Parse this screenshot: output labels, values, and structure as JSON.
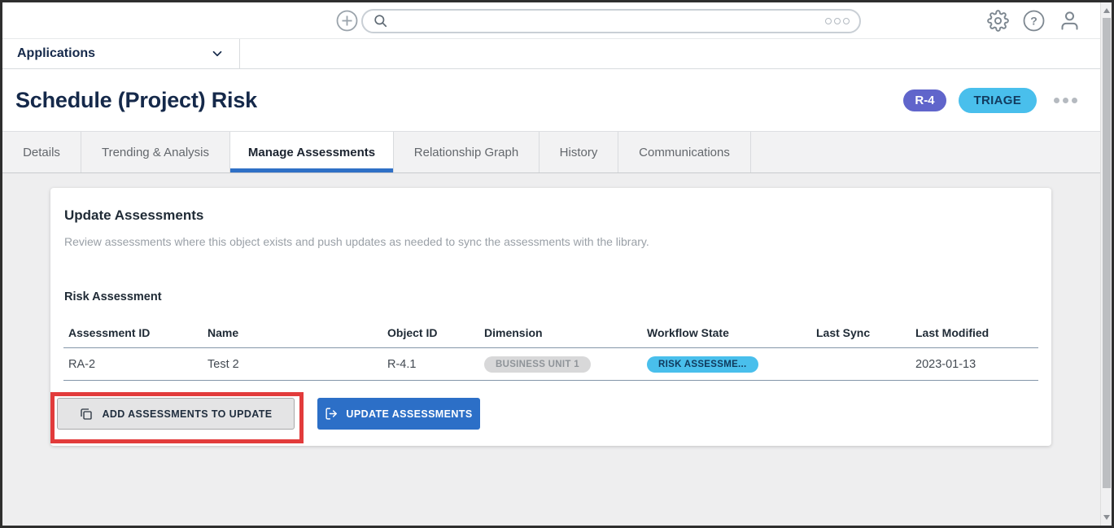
{
  "topbar": {
    "search": {
      "value": "",
      "placeholder": ""
    },
    "icons": {
      "plus": "plus-circle-icon",
      "search": "magnifier-icon",
      "search_options": "triple-dot-icon",
      "settings": "gear-icon",
      "help": "question-circle-icon",
      "user": "person-icon"
    }
  },
  "app_nav": {
    "label": "Applications"
  },
  "header": {
    "title": "Schedule (Project) Risk",
    "id_badge": "R-4",
    "state_badge": "TRIAGE"
  },
  "tabs": [
    {
      "label": "Details",
      "active": false
    },
    {
      "label": "Trending & Analysis",
      "active": false
    },
    {
      "label": "Manage Assessments",
      "active": true
    },
    {
      "label": "Relationship Graph",
      "active": false
    },
    {
      "label": "History",
      "active": false
    },
    {
      "label": "Communications",
      "active": false
    }
  ],
  "active_tab": "Manage Assessments",
  "card": {
    "title": "Update Assessments",
    "description": "Review assessments where this object exists and push updates as needed to sync the assessments with the library.",
    "section_title": "Risk Assessment",
    "table": {
      "columns": [
        "Assessment ID",
        "Name",
        "Object ID",
        "Dimension",
        "Workflow State",
        "Last Sync",
        "Last Modified"
      ],
      "rows": [
        {
          "assessment_id": "RA-2",
          "name": "Test 2",
          "object_id": "R-4.1",
          "dimension": "BUSINESS UNIT 1",
          "workflow_state": "RISK ASSESSME...",
          "last_sync": "",
          "last_modified": "2023-01-13"
        }
      ]
    },
    "buttons": {
      "add_label": "ADD ASSESSMENTS TO UPDATE",
      "update_label": "UPDATE ASSESSMENTS"
    }
  },
  "colors": {
    "title_text": "#15294a",
    "accent_button_blue": "#2c6fc7",
    "tab_underline_blue": "#2f70c6",
    "id_badge_bg": "#6065cb",
    "state_badge_bg": "#49bfec",
    "workflow_badge_bg": "#49bfec",
    "dimension_badge_bg": "#d8d8d9",
    "annotation_red": "#e23b3b",
    "content_bg": "#eeeeef"
  }
}
